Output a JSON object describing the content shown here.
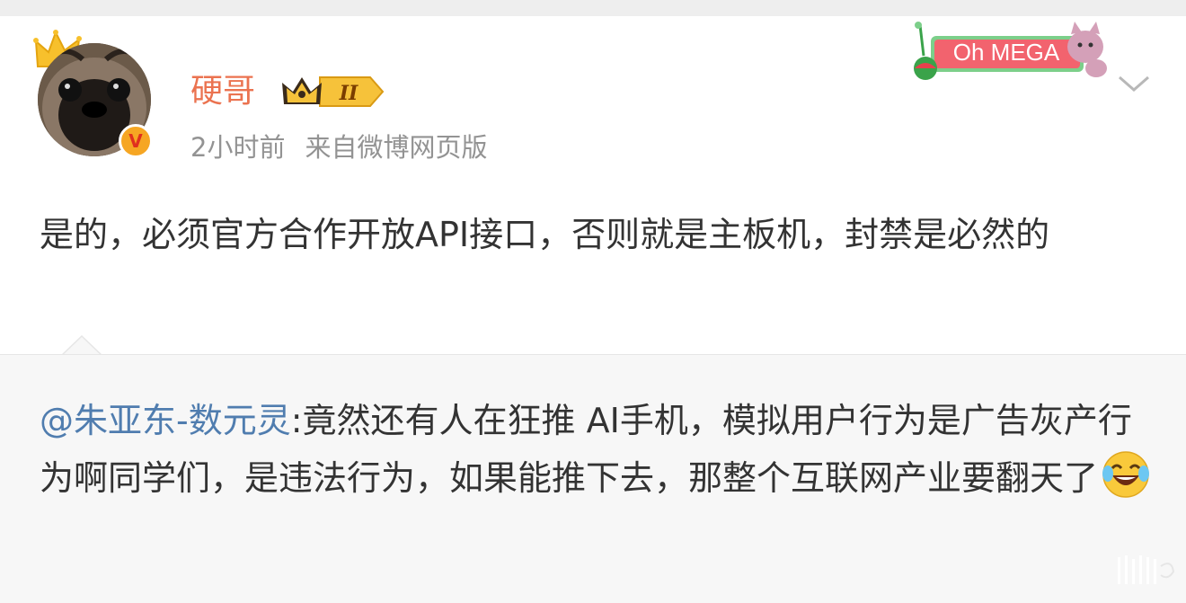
{
  "post": {
    "username": "硬哥",
    "vip_level": "II",
    "time": "2小时前",
    "source": "来自微博网页版",
    "text": "是的，必须官方合作开放API接口，否则就是主板机，封禁是必然的"
  },
  "decoration": {
    "banner_text": "Oh MEGA"
  },
  "quote": {
    "mention": "@朱亚东-数元灵",
    "separator": ":",
    "text": "竟然还有人在狂推 AI手机，模拟用户行为是广告灰产行为啊同学们，是违法行为，如果能推下去，那整个互联网产业要翻天了"
  },
  "icons": {
    "verified": "verified-v-icon",
    "crown": "crown-icon",
    "vip": "vip-crown-badge-icon",
    "more": "chevron-down-icon",
    "emoji": "laugh-cry-emoji",
    "watermark": "weibo-watermark-icon"
  },
  "colors": {
    "username": "#eb7350",
    "mention": "#507daf",
    "meta": "#939393",
    "verified_badge": "#f6a623",
    "banner": "#f2636e"
  }
}
